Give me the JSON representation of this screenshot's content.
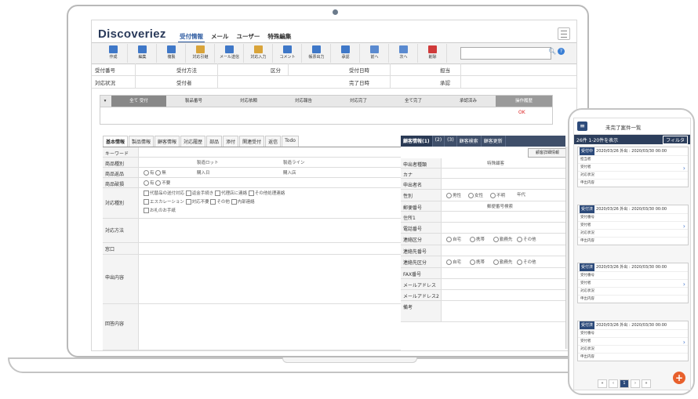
{
  "app": {
    "logo": "Discoveriez"
  },
  "nav": {
    "tabs": [
      "受付情報",
      "メール",
      "ユーザー",
      "特殊編集"
    ]
  },
  "toolbar": {
    "buttons": [
      "作成",
      "編集",
      "複製",
      "対応引継",
      "メール送信",
      "対応入力",
      "コメント",
      "帳票出力",
      "承認",
      "前へ",
      "次へ",
      "削除"
    ],
    "icon_colors": [
      "#3f78c8",
      "#3f78c8",
      "#3f78c8",
      "#d9a43a",
      "#3f78c8",
      "#d9a43a",
      "#3f78c8",
      "#3f78c8",
      "#3f78c8",
      "#5a8ad0",
      "#5a8ad0",
      "#d03a3a"
    ]
  },
  "info_rows": [
    [
      "受付番号",
      "受付方法",
      "区分",
      "受付日時",
      "担当"
    ],
    [
      "対応状況",
      "受付者",
      "",
      "完了日時",
      "承認"
    ]
  ],
  "status": {
    "steps": [
      "全て 受付",
      "製品番号",
      "対応依頼",
      "対応報告",
      "対応完了",
      "全て完了",
      "承認済み",
      "操作履歴"
    ],
    "marker": "OK"
  },
  "left_tabs": [
    "基本情報",
    "製品情報",
    "顧客情報",
    "対応履歴",
    "部品",
    "添付",
    "関連受付",
    "返信",
    "Todo"
  ],
  "left_form": {
    "keyword": "キーワード",
    "product_name": "商品種別",
    "lot_label": "製造ロット",
    "line_label": "製造ライン",
    "product_return": "商品返品",
    "return_options": [
      "有",
      "無"
    ],
    "buy_date": "購入日",
    "buy_store": "購入店",
    "product_damage": "商品破損",
    "damage_options": [
      "有",
      "不要"
    ],
    "category": "対応種別",
    "category_options": [
      "代替品の送付対応",
      "返金手続き",
      "代理店に連絡",
      "その他処理連絡",
      "エスカレーション",
      "対応不要",
      "その他",
      "内部連絡",
      "お礼のお手紙"
    ],
    "method": "対応方法",
    "window": "窓口",
    "request": "申出内容",
    "answer": "回答内容"
  },
  "right_tabs": [
    "顧客情報(1)",
    "(2)",
    "(3)",
    "顧客検索",
    "顧客更新"
  ],
  "right_button": "顧客詳細情報",
  "right_form": {
    "rows": [
      "申出者種類",
      "カナ",
      "申出者名",
      "性別",
      "郵便番号",
      "住所1",
      "電話番号",
      "連絡区分",
      "連絡先番号",
      "連絡先区分",
      "FAX番号",
      "メールアドレス",
      "メールアドレス2",
      "備考"
    ],
    "special": "特殊顧客",
    "gender_options": [
      "男性",
      "女性",
      "不明"
    ],
    "age_label": "年代",
    "address_btn": "郵便番号検索",
    "contact_options": [
      "自宅",
      "携帯",
      "勤務先",
      "その他"
    ],
    "contact_options2": [
      "自宅",
      "携帯",
      "勤務先",
      "その他"
    ]
  },
  "phone": {
    "title": "未完了案件一覧",
    "subheader": "26件 1-20件を表示",
    "filter_button": "フィルタ",
    "cards": [
      {
        "badge": "受付中",
        "head": "2020/03/26 外出 : 2020/03/30 00:00",
        "lines": [
          "担当者",
          "受付者",
          "対応状況",
          "申出内容"
        ]
      },
      {
        "badge": "受付済",
        "head": "2020/03/26 外出 : 2020/03/30 00:00",
        "lines": [
          "受付番号",
          "受付者",
          "対応状況",
          "申出内容"
        ]
      },
      {
        "badge": "受付済",
        "head": "2020/03/26 外出 : 2020/03/30 00:00",
        "lines": [
          "受付番号",
          "受付者",
          "対応状況",
          "申出内容"
        ]
      },
      {
        "badge": "受付済",
        "head": "2020/03/26 外出 : 2020/03/30 00:00",
        "lines": [
          "受付番号",
          "受付者",
          "対応状況",
          "申出内容"
        ]
      }
    ],
    "pager": [
      "«",
      "‹",
      "1",
      "›",
      "»"
    ],
    "fab": "+"
  }
}
